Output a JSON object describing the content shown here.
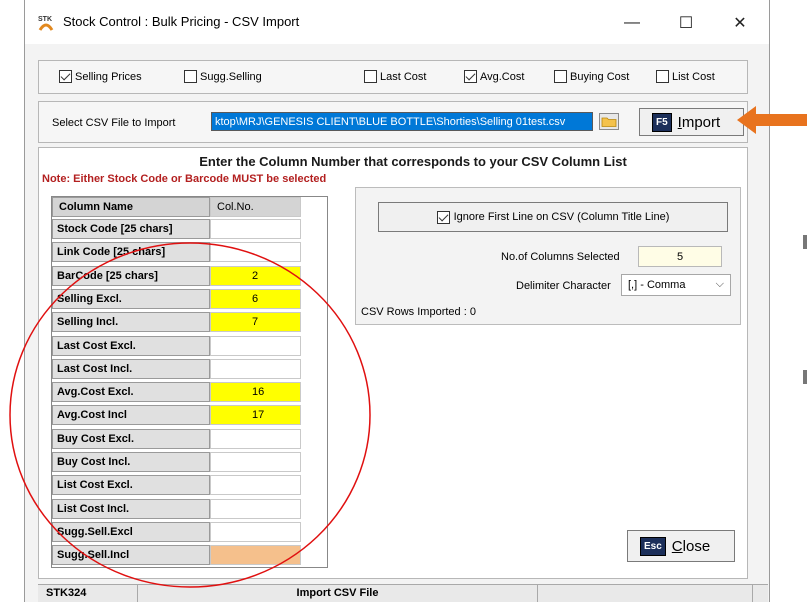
{
  "window": {
    "title": "Stock Control : Bulk Pricing - CSV Import",
    "minimize_glyph": "—",
    "maximize_glyph": "☐",
    "close_glyph": "✕"
  },
  "options": [
    {
      "label": "Selling Prices",
      "checked": true
    },
    {
      "label": "Sugg.Selling",
      "checked": false
    },
    {
      "label": "Last Cost",
      "checked": false
    },
    {
      "label": "Avg.Cost",
      "checked": true
    },
    {
      "label": "Buying Cost",
      "checked": false
    },
    {
      "label": "List Cost",
      "checked": false
    }
  ],
  "file": {
    "label": "Select CSV File to Import",
    "path": "ktop\\MRJ\\GENESIS CLIENT\\BLUE BOTTLE\\Shorties\\Selling 01test.csv",
    "import_key": "F5",
    "import_label": "Import"
  },
  "main": {
    "heading": "Enter the Column Number that corresponds to your CSV Column List",
    "note": "Note: Either Stock Code or Barcode MUST be selected"
  },
  "grid": {
    "headers": {
      "name": "Column Name",
      "col": "Col.No."
    },
    "rows": [
      {
        "name": "Stock Code [25 chars]",
        "col": "",
        "fill": "white"
      },
      {
        "name": "Link Code  [25 chars]",
        "col": "",
        "fill": "white"
      },
      {
        "name": "BarCode  [25 chars]",
        "col": "2",
        "fill": "yellow"
      },
      {
        "name": "Selling Excl.",
        "col": "6",
        "fill": "yellow"
      },
      {
        "name": "Selling Incl.",
        "col": "7",
        "fill": "yellow"
      },
      {
        "name": "Last Cost Excl.",
        "col": "",
        "fill": "white"
      },
      {
        "name": "Last Cost Incl.",
        "col": "",
        "fill": "white"
      },
      {
        "name": "Avg.Cost Excl.",
        "col": "16",
        "fill": "yellow"
      },
      {
        "name": "Avg.Cost Incl",
        "col": "17",
        "fill": "yellow"
      },
      {
        "name": "Buy Cost Excl.",
        "col": "",
        "fill": "white"
      },
      {
        "name": "Buy Cost Incl.",
        "col": "",
        "fill": "white"
      },
      {
        "name": "List Cost Excl.",
        "col": "",
        "fill": "white"
      },
      {
        "name": "List Cost Incl.",
        "col": "",
        "fill": "white"
      },
      {
        "name": "Sugg.Sell.Excl",
        "col": "",
        "fill": "white"
      },
      {
        "name": "Sugg.Sell.Incl",
        "col": "",
        "fill": "peach"
      }
    ]
  },
  "settings": {
    "ignore_first_line": "Ignore First Line on CSV (Column Title Line)",
    "ignore_checked": true,
    "ncols_label": "No.of Columns Selected",
    "ncols_value": "5",
    "delimiter_label": "Delimiter Character",
    "delimiter_value": "[,] - Comma",
    "csv_rows": "CSV Rows Imported : 0"
  },
  "close": {
    "key": "Esc",
    "label": "Close"
  },
  "status": {
    "code": "STK324",
    "text": "Import CSV File"
  },
  "colors": {
    "arrow": "#e8731e",
    "circle": "#e01010",
    "highlight": "#ffff00",
    "peach": "#f5c08c"
  }
}
